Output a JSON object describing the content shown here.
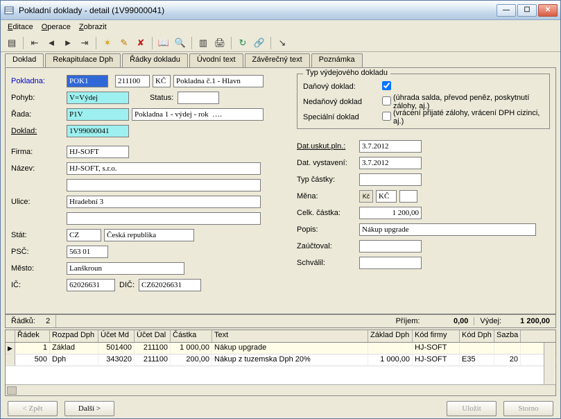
{
  "window": {
    "title": "Pokladní doklady - detail (1V99000041)"
  },
  "menu": {
    "editace": "Editace",
    "operace": "Operace",
    "zobrazit": "Zobrazit"
  },
  "tabs": {
    "doklad": "Doklad",
    "rekap": "Rekapitulace Dph",
    "radky": "Řádky dokladu",
    "uvod": "Úvodní text",
    "zaver": "Závěrečný text",
    "pozn": "Poznámka"
  },
  "left": {
    "pokladna_lbl": "Pokladna:",
    "pokladna": "POK1",
    "pokladna_code": "211100",
    "kc": "KČ",
    "pokl_desc": "Pokladna č.1 - Hlavn",
    "pohyb_lbl": "Pohyb:",
    "pohyb": "V=Výdej",
    "status_lbl": "Status:",
    "rada_lbl": "Řada:",
    "rada": "P1V",
    "rada_desc": "Pokladna 1 - výdej - rok  ….",
    "doklad_lbl": "Doklad:",
    "doklad": "1V99000041",
    "firma_lbl": "Firma:",
    "firma": "HJ-SOFT",
    "nazev_lbl": "Název:",
    "nazev": "HJ-SOFT, s.r.o.",
    "nazev2": "",
    "ulice_lbl": "Ulice:",
    "ulice": "Hradební 3",
    "ulice2": "",
    "stat_lbl": "Stát:",
    "stat": "CZ",
    "stat_name": "Česká republika",
    "psc_lbl": "PSČ:",
    "psc": "563 01",
    "mesto_lbl": "Město:",
    "mesto": "Lanškroun",
    "ic_lbl": "IČ:",
    "ic": "62026631",
    "dic_lbl": "DIČ:",
    "dic": "CZ62026631"
  },
  "group": {
    "legend": "Typ výdejového dokladu",
    "dan_lbl": "Daňový doklad:",
    "dan_chk": true,
    "nedan_lbl": "Nedaňový doklad",
    "nedan_chk": false,
    "nedan_hint": "(úhrada salda, převod peněz, poskytnutí zálohy, aj.)",
    "spec_lbl": "Speciální doklad",
    "spec_chk": false,
    "spec_hint": "(vrácení přijaté zálohy, vrácení DPH cizinci, aj.)"
  },
  "right": {
    "dat_uskut_lbl": "Dat.uskut.pln.:",
    "dat_uskut": "3.7.2012",
    "dat_vyst_lbl": "Dat. vystavení:",
    "dat_vyst": "3.7.2012",
    "typ_castky_lbl": "Typ částky:",
    "typ_castky": "",
    "mena_lbl": "Měna:",
    "mena": "KČ",
    "celk_lbl": "Celk. částka:",
    "celk": "1 200,00",
    "popis_lbl": "Popis:",
    "popis": "Nákup upgrade",
    "zauct_lbl": "Zaúčtoval:",
    "zauct": "",
    "schval_lbl": "Schválil:",
    "schval": ""
  },
  "summary": {
    "radku_lbl": "Řádků:",
    "radku": "2",
    "prijem_lbl": "Příjem:",
    "prijem": "0,00",
    "vydej_lbl": "Výdej:",
    "vydej": "1 200,00"
  },
  "gridhead": {
    "radek": "Řádek",
    "rozpad": "Rozpad Dph",
    "ucetmd": "Účet Md",
    "ucetdal": "Účet Dal",
    "castka": "Částka",
    "text": "Text",
    "zaklad": "Základ Dph",
    "kodfirmy": "Kód firmy",
    "koddph": "Kód Dph",
    "sazba": "Sazba"
  },
  "gridrows": [
    {
      "radek": "1",
      "rozpad": "Základ",
      "ucetmd": "501400",
      "ucetdal": "211100",
      "castka": "1 000,00",
      "text": "Nákup upgrade",
      "zaklad": "",
      "kodfirmy": "HJ-SOFT",
      "koddph": "",
      "sazba": ""
    },
    {
      "radek": "500",
      "rozpad": "Dph",
      "ucetmd": "343020",
      "ucetdal": "211100",
      "castka": "200,00",
      "text": "Nákup z tuzemska Dph 20%",
      "zaklad": "1 000,00",
      "kodfirmy": "HJ-SOFT",
      "koddph": "E35",
      "sazba": "20"
    }
  ],
  "footer": {
    "zpet": "< Zpět",
    "dalsi": "Další >",
    "ulozit": "Uložit",
    "storno": "Storno"
  }
}
